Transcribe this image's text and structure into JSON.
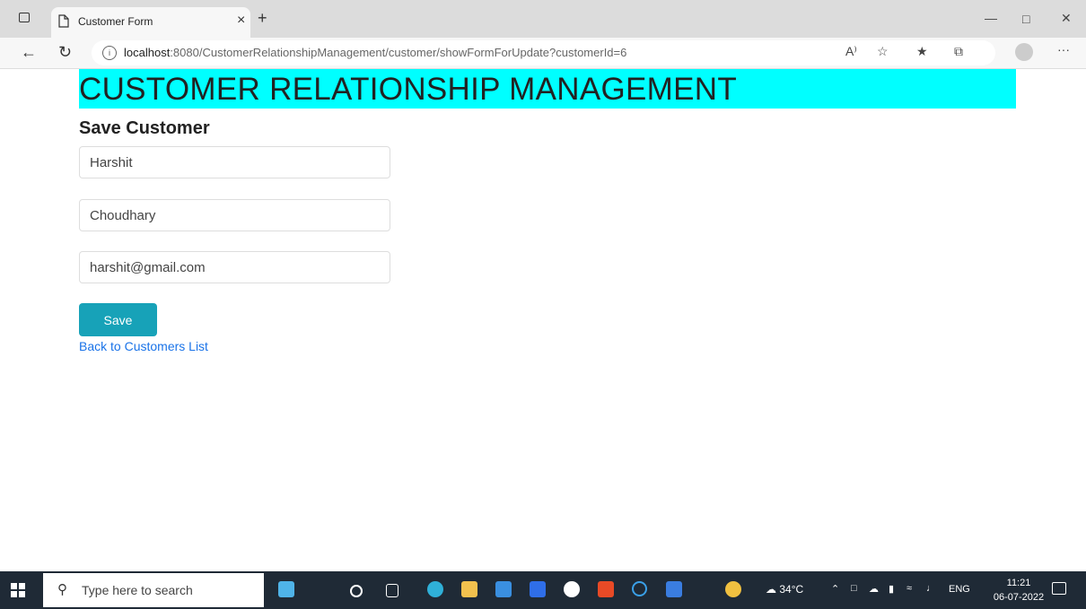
{
  "browser": {
    "tab_title": "Customer Form",
    "tab_close": "×",
    "new_tab": "+",
    "url_host": "localhost",
    "url_path": ":8080/CustomerRelationshipManagement/customer/showFormForUpdate?customerId=6",
    "read_aloud": "A⁾",
    "more": "···"
  },
  "page": {
    "header": "CUSTOMER RELATIONSHIP MANAGEMENT",
    "subtitle": "Save Customer",
    "form": {
      "first_name": "Harshit",
      "last_name": "Choudhary",
      "email": "harshit@gmail.com",
      "save_label": "Save"
    },
    "back_link": "Back to Customers List"
  },
  "taskbar": {
    "search_placeholder": "Type here to search",
    "temperature": "34°C",
    "language": "ENG",
    "time": "11:21",
    "date": "06-07-2022"
  },
  "colors": {
    "header_bg": "#00ffff",
    "save_button": "#17a2b8",
    "link": "#1a73e8"
  }
}
